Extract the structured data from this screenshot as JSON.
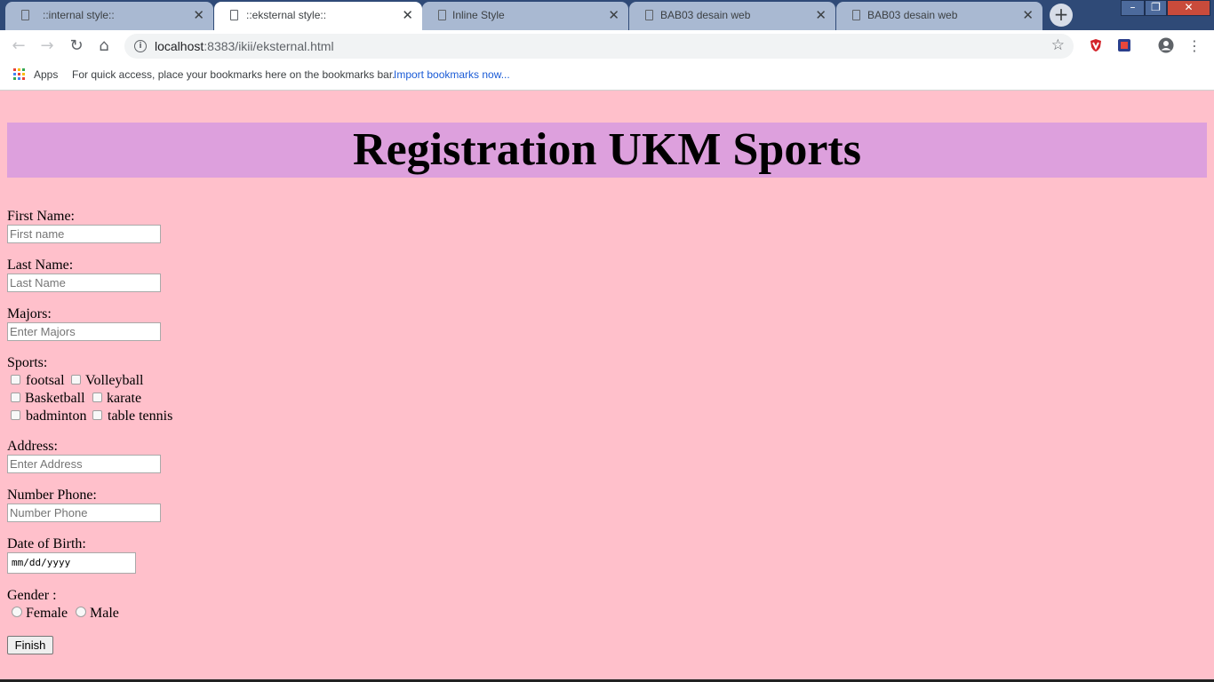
{
  "browser": {
    "tabs": [
      {
        "title": "::internal style::",
        "close": "✕"
      },
      {
        "title": "::eksternal style::",
        "close": "✕"
      },
      {
        "title": "Inline Style",
        "close": "✕"
      },
      {
        "title": "BAB03 desain web",
        "close": "✕"
      },
      {
        "title": "BAB03 desain web",
        "close": "✕"
      }
    ],
    "active_tab_index": 1,
    "url_host": "localhost",
    "url_path": ":8383/ikii/eksternal.html",
    "bookmarks_bar": {
      "apps": "Apps",
      "hint": "For quick access, place your bookmarks here on the bookmarks bar.",
      "import_link": "Import bookmarks now..."
    }
  },
  "page": {
    "heading": "Registration UKM Sports",
    "fields": {
      "first_name": {
        "label": "First Name:",
        "placeholder": "First name"
      },
      "last_name": {
        "label": "Last Name:",
        "placeholder": "Last Name"
      },
      "majors": {
        "label": "Majors:",
        "placeholder": "Enter Majors"
      },
      "address": {
        "label": "Address:",
        "placeholder": "Enter Address"
      },
      "phone": {
        "label": "Number Phone:",
        "placeholder": "Number Phone"
      },
      "dob": {
        "label": "Date of Birth:",
        "value": "mm/dd/yyyy"
      }
    },
    "sports": {
      "label": "Sports:",
      "options": [
        "footsal",
        "Volleyball",
        "Basketball",
        "karate",
        "badminton",
        "table tennis"
      ]
    },
    "gender": {
      "label": "Gender :",
      "options": [
        "Female",
        "Male"
      ]
    },
    "finish_label": "Finish"
  },
  "colors": {
    "page_background": "#ffc0cb",
    "banner_background": "#dda0dd"
  }
}
